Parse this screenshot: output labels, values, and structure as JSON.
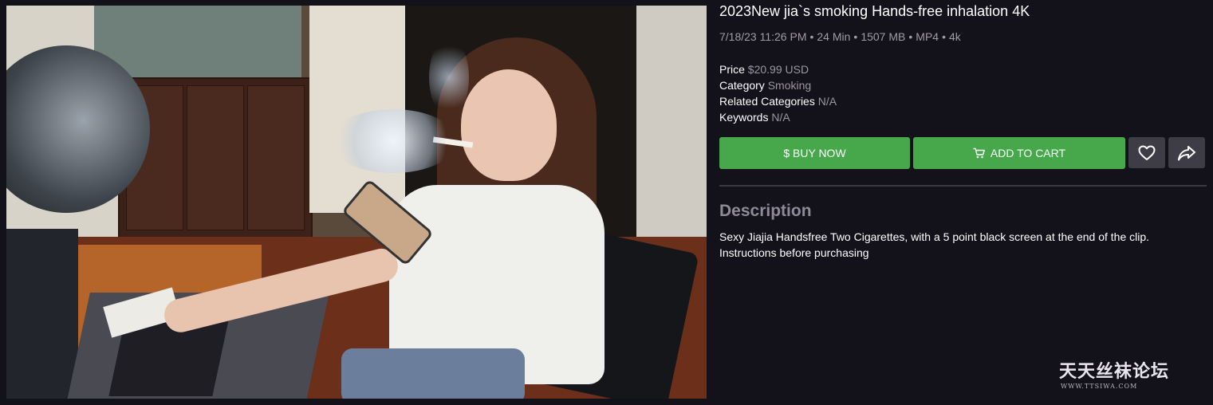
{
  "product": {
    "title": "2023New jia`s smoking Hands-free inhalation 4K",
    "meta": {
      "date": "7/18/23 11:26 PM",
      "duration": "24 Min",
      "size": "1507 MB",
      "format": "MP4",
      "resolution": "4k",
      "separator": "•"
    },
    "attributes": {
      "price_label": "Price",
      "price_value": "$20.99 USD",
      "category_label": "Category",
      "category_value": "Smoking",
      "related_label": "Related Categories",
      "related_value": "N/A",
      "keywords_label": "Keywords",
      "keywords_value": "N/A"
    },
    "actions": {
      "buy_now": "$ BUY NOW",
      "add_to_cart": "ADD TO CART",
      "favorite_icon": "heart-icon",
      "share_icon": "share-icon"
    },
    "description": {
      "heading": "Description",
      "line1": "Sexy Jiajia Handsfree Two Cigarettes, with a 5 point black screen at the end of the clip.",
      "line2": "Instructions before purchasing"
    }
  },
  "watermark": {
    "main": "天天丝袜论坛",
    "sub": "WWW.TTSIWA.COM"
  },
  "colors": {
    "background": "#13111a",
    "accent_green": "#47a84b",
    "icon_button": "#3e3c46",
    "muted_text": "#a09ca8",
    "heading_muted": "#8e8a98"
  }
}
